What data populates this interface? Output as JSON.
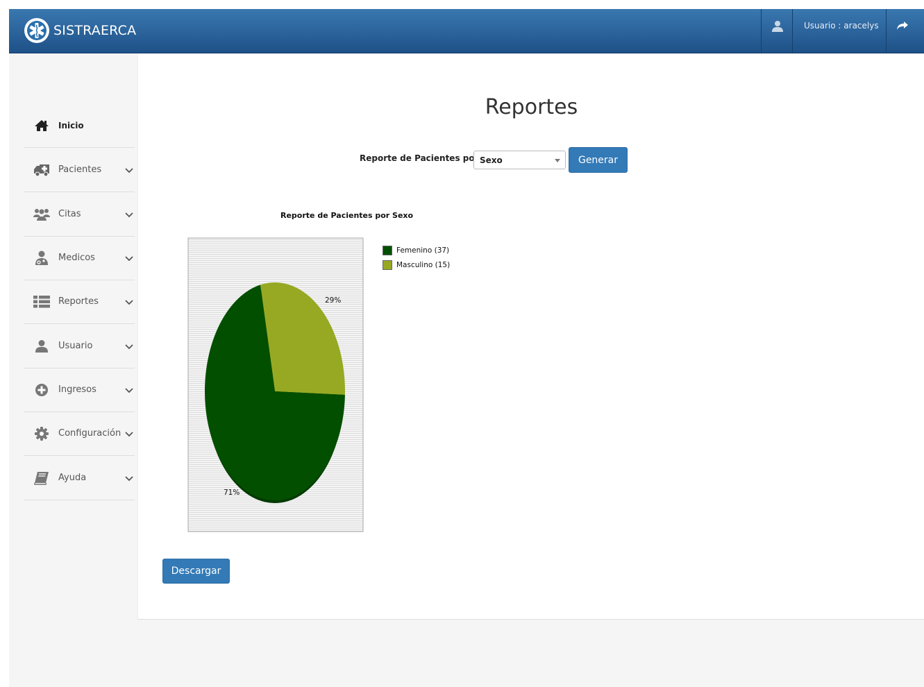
{
  "app": {
    "brand": "SISTRAERCA"
  },
  "header": {
    "user_label": "Usuario : aracelys"
  },
  "colors": {
    "header_top": "#3a78b0",
    "header_bottom": "#1e5188",
    "primary": "#337ab7",
    "femenino": "#034f00",
    "masculino": "#97a923"
  },
  "sidebar": {
    "items": [
      {
        "label": "Inicio",
        "icon": "home-icon",
        "active": true,
        "expandable": false
      },
      {
        "label": "Pacientes",
        "icon": "ambulance-icon",
        "active": false,
        "expandable": true
      },
      {
        "label": "Citas",
        "icon": "users-icon",
        "active": false,
        "expandable": true
      },
      {
        "label": "Medicos",
        "icon": "user-md-icon",
        "active": false,
        "expandable": true
      },
      {
        "label": "Reportes",
        "icon": "list-icon",
        "active": false,
        "expandable": true
      },
      {
        "label": "Usuario",
        "icon": "user-icon",
        "active": false,
        "expandable": true
      },
      {
        "label": "Ingresos",
        "icon": "plus-circle-icon",
        "active": false,
        "expandable": true
      },
      {
        "label": "Configuración",
        "icon": "gear-icon",
        "active": false,
        "expandable": true
      },
      {
        "label": "Ayuda",
        "icon": "book-icon",
        "active": false,
        "expandable": true
      }
    ]
  },
  "main": {
    "title": "Reportes",
    "form_label": "Reporte de Pacientes por:",
    "select_value": "Sexo",
    "generate_label": "Generar",
    "download_label": "Descargar"
  },
  "chart_data": {
    "type": "pie",
    "title": "Reporte de Pacientes por Sexo",
    "slices": [
      {
        "label": "Femenino (37)",
        "name": "Femenino",
        "value": 37,
        "percent_label": "71%",
        "color": "#034f00"
      },
      {
        "label": "Masculino (15)",
        "name": "Masculino",
        "value": 15,
        "percent_label": "29%",
        "color": "#97a923"
      }
    ],
    "legend_position": "right"
  }
}
